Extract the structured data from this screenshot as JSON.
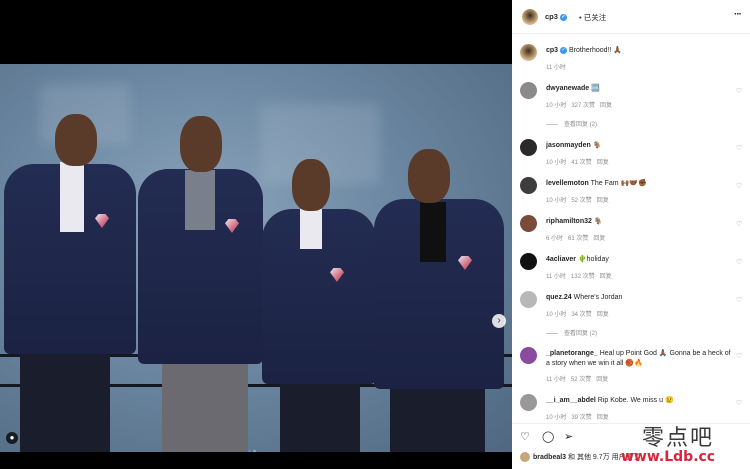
{
  "post": {
    "username": "cp3",
    "follow_status": "已关注",
    "caption_user": "cp3",
    "caption_text": "Brotherhood!! 🙏🏾",
    "caption_time": "11 小时"
  },
  "comments": [
    {
      "user": "dwyanewade",
      "text": "🆒",
      "time": "10 小时",
      "likes": "327 次赞",
      "reply": "回复",
      "view_replies": "查看回复 (2)",
      "avatar_color": "#8a8a8a"
    },
    {
      "user": "jasonmayden",
      "text": "🐐",
      "time": "10 小时",
      "likes": "41 次赞",
      "reply": "回复",
      "avatar_color": "#2a2a2a"
    },
    {
      "user": "levellemoton",
      "text": "The Fam 🙌🏾🤝🏾✊🏾",
      "time": "10 小时",
      "likes": "52 次赞",
      "reply": "回复",
      "avatar_color": "#3d3d3d"
    },
    {
      "user": "riphamilton32",
      "text": "🐐",
      "time": "6 小时",
      "likes": "61 次赞",
      "reply": "回复",
      "avatar_color": "#7a4a3a"
    },
    {
      "user": "4acliaver",
      "text": "🌵holiday",
      "time": "11 小时",
      "likes": "132 次赞",
      "reply": "回复",
      "avatar_color": "#111111"
    },
    {
      "user": "quez.24",
      "text": "Where's Jordan",
      "time": "10 小时",
      "likes": "34 次赞",
      "reply": "回复",
      "view_replies": "查看回复 (2)",
      "avatar_color": "#b8b8b8"
    },
    {
      "user": "_planetorange_",
      "text": "Heal up Point God 🙏🏾 Gonna be a heck of a story when we win it all 🏀🔥",
      "time": "11 小时",
      "likes": "52 次赞",
      "reply": "回复",
      "avatar_color": "#8a4aa0"
    },
    {
      "user": "__i_am__abdel",
      "text": "Rip Kobe. We miss u 😢",
      "time": "10 小时",
      "likes": "39 次赞",
      "reply": "回复",
      "avatar_color": "#999999"
    }
  ],
  "actions": {
    "like_icon": "♡",
    "comment_icon": "◯",
    "share_icon": "➢"
  },
  "likes_line": {
    "user": "bradbeal3",
    "text": "和 其他 9.7万 用户赞了"
  },
  "photo": {
    "next_icon": "›",
    "user_tag_icon": "●"
  },
  "watermark": {
    "cn": "零点吧",
    "url": "www.Ldb.cc"
  },
  "header": {
    "more_icon": "···"
  }
}
